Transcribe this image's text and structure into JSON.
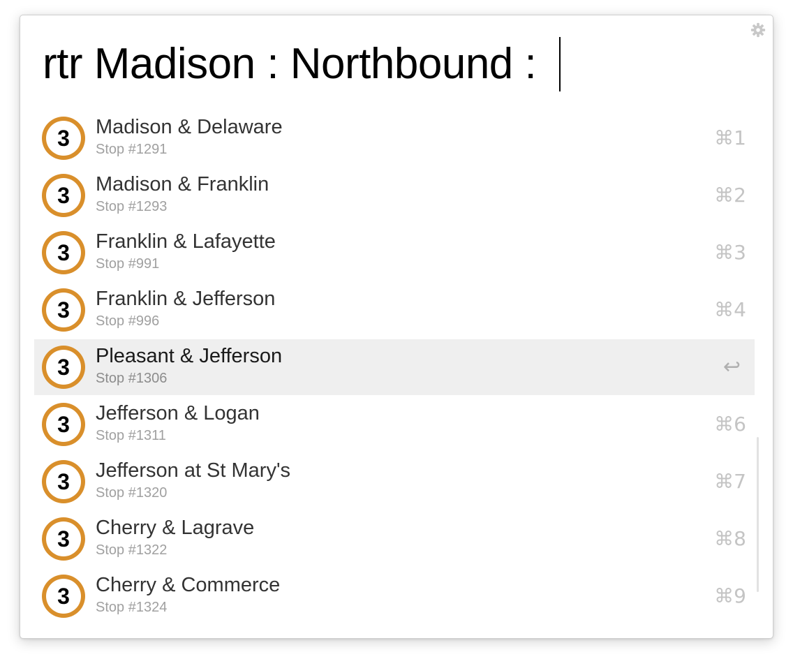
{
  "search": {
    "query": "rtr Madison : Northbound : "
  },
  "icons": {
    "settings": "gear-icon",
    "route_badge": "route-3-badge-icon",
    "route_number": "3",
    "route_ring_color": "#d98f2b"
  },
  "results": [
    {
      "title": "Madison & Delaware",
      "subtitle": "Stop #1291",
      "shortcut": "⌘1",
      "selected": false
    },
    {
      "title": "Madison & Franklin",
      "subtitle": "Stop #1293",
      "shortcut": "⌘2",
      "selected": false
    },
    {
      "title": "Franklin & Lafayette",
      "subtitle": "Stop #991",
      "shortcut": "⌘3",
      "selected": false
    },
    {
      "title": "Franklin & Jefferson",
      "subtitle": "Stop #996",
      "shortcut": "⌘4",
      "selected": false
    },
    {
      "title": "Pleasant & Jefferson",
      "subtitle": "Stop #1306",
      "shortcut": "↩",
      "selected": true
    },
    {
      "title": "Jefferson & Logan",
      "subtitle": "Stop #1311",
      "shortcut": "⌘6",
      "selected": false
    },
    {
      "title": "Jefferson at St Mary's",
      "subtitle": "Stop #1320",
      "shortcut": "⌘7",
      "selected": false
    },
    {
      "title": "Cherry & Lagrave",
      "subtitle": "Stop #1322",
      "shortcut": "⌘8",
      "selected": false
    },
    {
      "title": "Cherry & Commerce",
      "subtitle": "Stop #1324",
      "shortcut": "⌘9",
      "selected": false
    }
  ]
}
